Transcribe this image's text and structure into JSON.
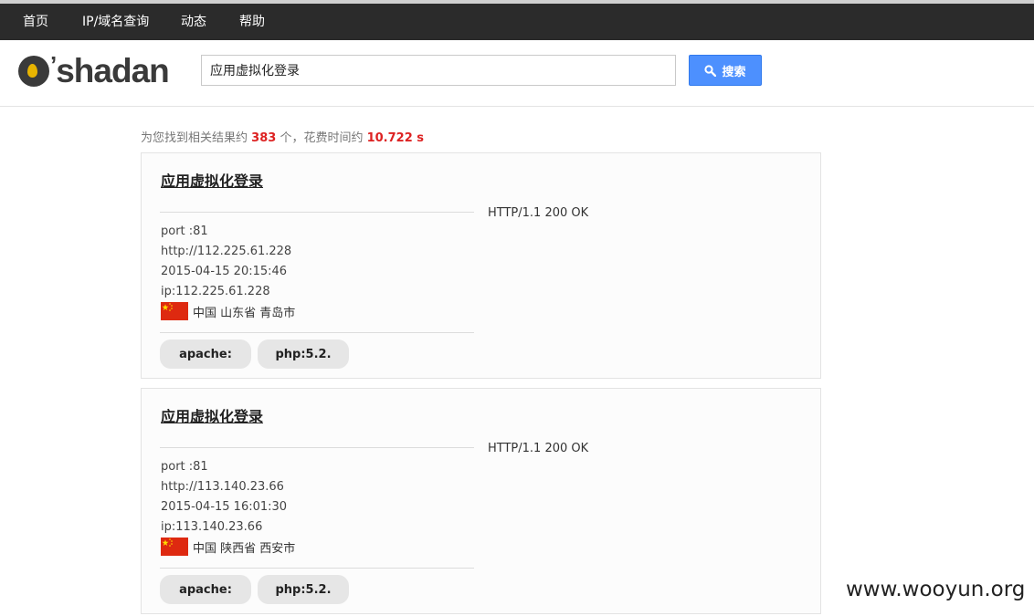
{
  "nav": {
    "items": [
      {
        "label": "首页"
      },
      {
        "label": "IP/域名查询"
      },
      {
        "label": "动态"
      },
      {
        "label": "帮助"
      }
    ]
  },
  "brand": {
    "logo_text": "shadan",
    "accent": "#e8b400"
  },
  "search": {
    "value": "应用虚拟化登录",
    "button_label": "搜索",
    "button_color": "#4d90fe"
  },
  "summary": {
    "prefix": "为您找到相关结果约",
    "count": "383",
    "middle": "个，花费时间约",
    "time": "10.722 s"
  },
  "results": [
    {
      "title": "应用虚拟化登录",
      "http_status": "HTTP/1.1 200 OK",
      "port": "port :81",
      "url": "http://112.225.61.228",
      "date": "2015-04-15 20:15:46",
      "ip": "ip:112.225.61.228",
      "flag_icon": "china-flag-icon",
      "location": "中国 山东省 青岛市",
      "tags": [
        "apache:",
        "php:5.2."
      ]
    },
    {
      "title": "应用虚拟化登录",
      "http_status": "HTTP/1.1 200 OK",
      "port": "port :81",
      "url": "http://113.140.23.66",
      "date": "2015-04-15 16:01:30",
      "ip": "ip:113.140.23.66",
      "flag_icon": "china-flag-icon",
      "location": "中国 陕西省 西安市",
      "tags": [
        "apache:",
        "php:5.2."
      ]
    }
  ],
  "watermark": "www.wooyun.org"
}
